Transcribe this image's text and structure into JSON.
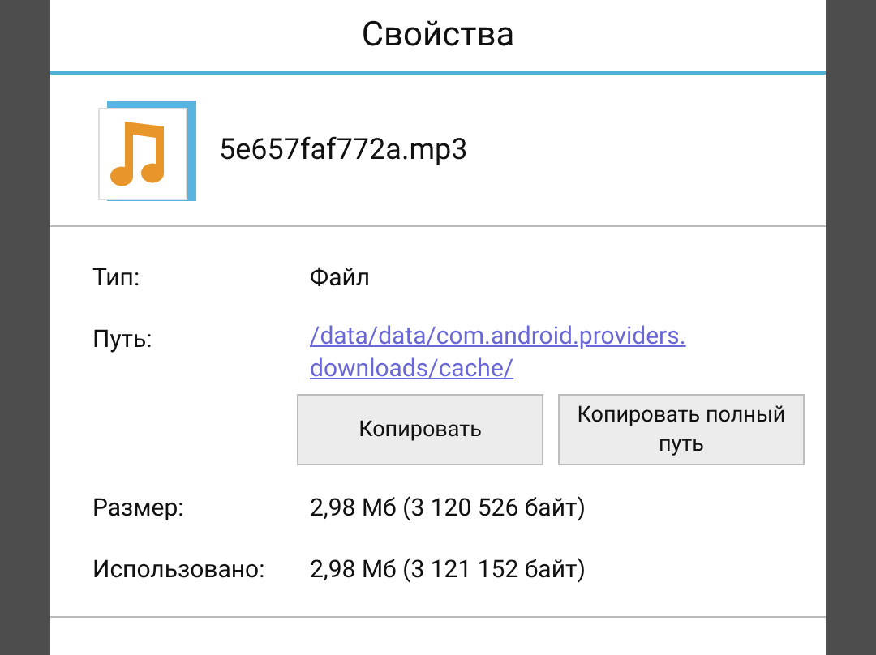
{
  "dialog": {
    "title": "Свойства",
    "file": {
      "name": "5e657faf772a.mp3"
    },
    "properties": [
      {
        "kind": "text",
        "label": "Тип:",
        "value": "Файл"
      },
      {
        "kind": "link",
        "label": "Путь:",
        "lines": [
          "/data/data/com.android.providers.",
          "downloads/cache/"
        ]
      },
      {
        "kind": "buttons",
        "buttons": [
          "Копировать",
          "Копировать полный путь"
        ]
      },
      {
        "kind": "text",
        "label": "Размер:",
        "value": "2,98 Мб (3 120 526 байт)"
      },
      {
        "kind": "text",
        "label": "Использовано:",
        "value": "2,98 Мб (3 121 152 байт)"
      }
    ]
  }
}
